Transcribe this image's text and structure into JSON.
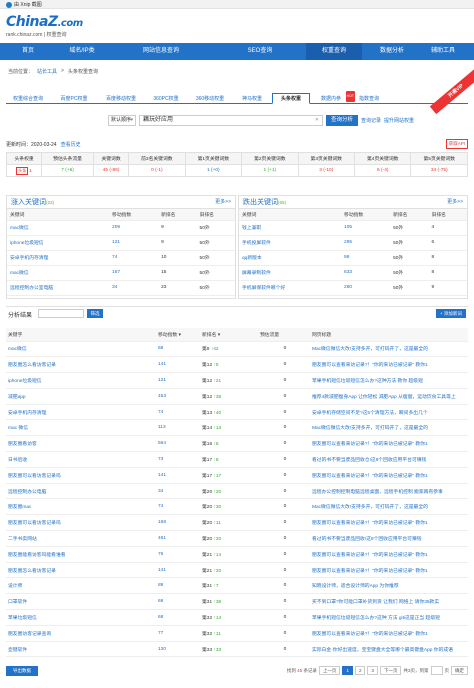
{
  "topbar": {
    "label": "由 Xnip 截图"
  },
  "header": {
    "logo": "China",
    "logo_z": "Z",
    "logo_tld": ".com",
    "sub": "rank.chinaz.com | 权重查询"
  },
  "nav": [
    "首页",
    "域名/IP类",
    "网站信息查询",
    "SEO查询",
    "权重查询",
    "数据分析",
    "辅助工具"
  ],
  "crumb": {
    "prefix": "当前位置：",
    "link": "站长工具",
    "sep": ">",
    "current": "头条权重查询"
  },
  "tabs": [
    "权重综合查询",
    "百度PC权重",
    "百度移动权重",
    "360PC权重",
    "360移动权重",
    "神马权重",
    "头条权重",
    "数据内参",
    "指数查询"
  ],
  "tab_hot": "HOT",
  "ribbon": "开通VIP",
  "search": {
    "select": "默认顺序",
    "value": "藕玩好应用",
    "button": "查询分析",
    "link1": "查询记录",
    "link2": "提升网站权重"
  },
  "update": {
    "label": "更新时间：2020-03-24",
    "link": "查看历史"
  },
  "api": "获取API",
  "overview": {
    "headers": [
      "头条权重",
      "预估头条流量",
      "关键词数",
      "前3名关键词数",
      "第1页关键词数",
      "第2页关键词数",
      "第3页关键词数",
      "第4页关键词数",
      "第5页关键词数"
    ],
    "values": [
      "1",
      "7 (+6)",
      "45 (-89)",
      "0 (-1)",
      "1 (+0)",
      "1 (+1)",
      "3 (-10)",
      "6 (-4)",
      "34 (-75)"
    ],
    "pin": "头条"
  },
  "up_panel": {
    "title": "涨入关键词",
    "count": "(23)",
    "more": "更多>>",
    "headers": [
      "关键词",
      "移动指数",
      "新排名",
      "旧排名"
    ],
    "rows": [
      [
        "mac微信",
        "209",
        "9",
        "50外"
      ],
      [
        "iphone垃圾短信",
        "121",
        "9",
        "50外"
      ],
      [
        "安卓手机内存清理",
        "74",
        "10",
        "50外"
      ],
      [
        "mac微信",
        "157",
        "15",
        "50外"
      ],
      [
        "远程控制办公室电脑",
        "34",
        "23",
        "50外"
      ]
    ]
  },
  "down_panel": {
    "title": "跌出关键词",
    "count": "(65)",
    "more": "更多>>",
    "headers": [
      "关键词",
      "移动指数",
      "新排名",
      "旧排名"
    ],
    "rows": [
      [
        "钱上兼职",
        "105",
        "50外",
        "4"
      ],
      [
        "手机投屏软件",
        "295",
        "50外",
        "6"
      ],
      [
        "qq新版本",
        "98",
        "50外",
        "8"
      ],
      [
        "屏幕录制软件",
        "633",
        "50外",
        "8"
      ],
      [
        "手机屏保软件哪个好",
        "280",
        "50外",
        "9"
      ]
    ]
  },
  "analysis": {
    "title": "分析结果",
    "filter": "筛选",
    "add": "+ 添加新词"
  },
  "main_headers": [
    "关键字",
    "移动指数 ▾",
    "新排名 ▾",
    "预估流量",
    "网页标题"
  ],
  "main_rows": [
    [
      "mac微信",
      "68",
      "第9",
      "↑42",
      "0",
      "Mac微信微信大改!支持多开，可打码开了，这是最全的"
    ],
    [
      "朋友圈怎么看访客记录",
      "141",
      "第12",
      "↑5",
      "0",
      "朋友圈可以查看来访记录?！\"你的来访已被记录\" 教你1"
    ],
    [
      "iphone垃圾短信",
      "121",
      "第12",
      "↑21",
      "0",
      "苹果手机短信垃圾短信怎么办?这种方法 教你 超级短"
    ],
    [
      "减肥app",
      "453",
      "第12",
      "↑38",
      "0",
      "推荐4款减肥瘦身App 让你轻松 减肥App 从瘦腿，运动饮食工具等上"
    ],
    [
      "安卓手机内存清理",
      "74",
      "第13",
      "↑40",
      "0",
      "安卓手机存储空间不足?这5个清理方法，瞬间多出几个"
    ],
    [
      "mac 微信",
      "113",
      "第14",
      "↑13",
      "0",
      "Mac微信微信大改!支持多开，可打码开了，这是最全的"
    ],
    [
      "朋友圈看访客",
      "564",
      "第16",
      "↑6",
      "0",
      "朋友圈可以查看来访记录?！\"你的来访已被记录\" 教你1"
    ],
    [
      "日书后收",
      "73",
      "第17",
      "↑8",
      "0",
      "看过的书不要当废品回收仓!这9个回收应用平台可赚钱"
    ],
    [
      "朋友圈可以看访客记录吗",
      "141",
      "第17",
      "↑17",
      "0",
      "朋友圈可以查看来访记录?！\"你的来访已被记录\" 教你1"
    ],
    [
      "远程控制办公电脑",
      "34",
      "第20",
      "↑20",
      "0",
      "远程办公控制控制电脑远程桌面，远程手机控制 搬家再有参事"
    ],
    [
      "朋友圈mac",
      "74",
      "第20",
      "↑30",
      "0",
      "Mac微信微信大改!支持多开，可打码开了，这是最全的"
    ],
    [
      "朋友圈可以看访客记录吗",
      "168",
      "第20",
      "↑11",
      "0",
      "朋友圈可以查看来访记录?！\"你的来访已被记录\" 教你1"
    ],
    [
      "二手书卖网站",
      "461",
      "第20",
      "↑20",
      "0",
      "看过的书不要当废品回收!这9个回收应用平台可赚钱"
    ],
    [
      "朋友圈能看访客吗能看谁看",
      "76",
      "第21",
      "↑14",
      "0",
      "朋友圈可以查看来访记录?！\"你的来访已被记录\" 教你1"
    ],
    [
      "朋友圈怎么看访客记录",
      "141",
      "第21",
      "↑20",
      "0",
      "朋友圈可以查看来访记录?！\"你的来访已被记录\" 教你1"
    ],
    [
      "设计师",
      "89",
      "第31",
      "↑7",
      "0",
      "知晓设计师，适合设计师的App 为你推荐"
    ],
    [
      "口罩软件",
      "69",
      "第31",
      "↑36",
      "0",
      "买不到口罩?你可能口罩补货到货 让我们 网络上 请你35款实"
    ],
    [
      "苹果垃圾短信",
      "68",
      "第32",
      "↑14",
      "0",
      "苹果手机短信垃圾短信怎么办?这种 方法 giti这是正当 超级短"
    ],
    [
      "朋友圈访客记录查询",
      "77",
      "第32",
      "↑11",
      "0",
      "朋友圈可以查看来访记录?！\"你的来访已被记录\" 教你1"
    ],
    [
      "壶键软件",
      "130",
      "第33",
      "↑33",
      "0",
      "实际白金·你好出速度，宝宝键盘大全等哪个最高键盘App 你的成语"
    ]
  ],
  "footer": {
    "export": "导出数据",
    "total_a": "找到",
    "total_n": "45",
    "total_b": "条记录",
    "prev": "上一页",
    "p1": "1",
    "p2": "2",
    "p3": "3",
    "next": "下一页",
    "pages": "共3页，到第",
    "go": "页",
    "btn": "确定"
  },
  "colors": {
    "primary": "#2272c7",
    "up": "#3a3",
    "down": "#e33"
  }
}
